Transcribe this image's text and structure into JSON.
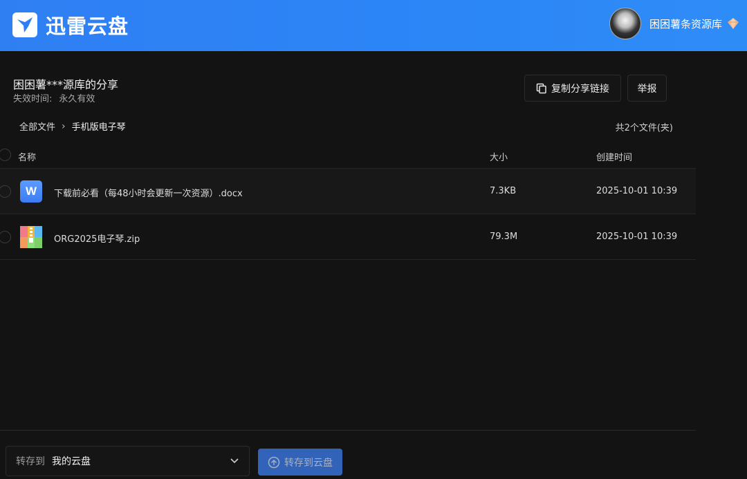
{
  "header": {
    "brand": "迅雷云盘",
    "user_name": "困困薯条资源库",
    "colors": {
      "header_bg": "#2f7ff3",
      "page_bg": "#131314",
      "primary_button": "#3c7ff1"
    }
  },
  "share": {
    "title": "困困薯***源库的分享",
    "expire_label": "失效时间:",
    "expire_value": "永久有效",
    "copy_link_label": "复制分享链接",
    "report_label": "举报"
  },
  "breadcrumb": {
    "root": "全部文件",
    "current": "手机版电子琴"
  },
  "file_count": "共2个文件(夹)",
  "table": {
    "columns": [
      "名称",
      "大小",
      "创建时间"
    ],
    "rows": [
      {
        "icon": "word-doc-icon",
        "name": "下载前必看（每48小时会更新一次资源）.docx",
        "size": "7.3KB",
        "created": "2025-10-01 10:39"
      },
      {
        "icon": "zip-archive-icon",
        "name": "ORG2025电子琴.zip",
        "size": "79.3M",
        "created": "2025-10-01 10:39"
      }
    ]
  },
  "footer": {
    "save_to_label": "转存到",
    "save_to_value": "我的云盘",
    "save_button_label": "转存到云盘"
  }
}
